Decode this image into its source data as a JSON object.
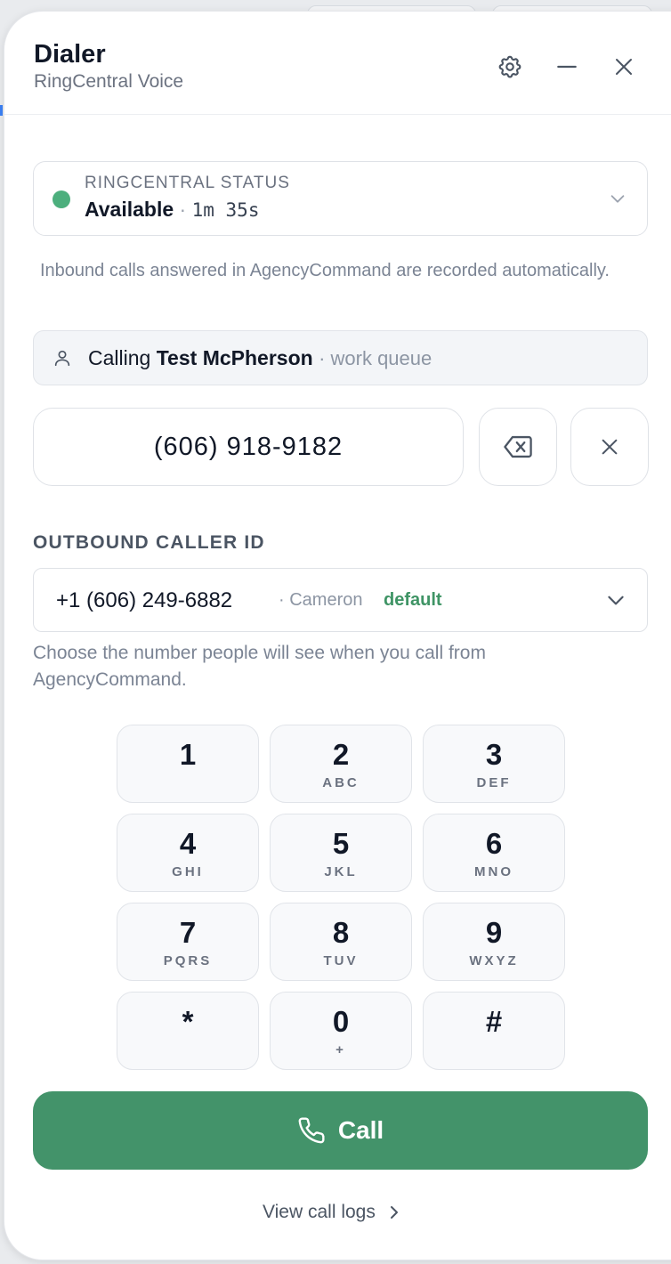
{
  "header": {
    "title": "Dialer",
    "subtitle": "RingCentral Voice"
  },
  "status": {
    "label": "RINGCENTRAL STATUS",
    "value": "Available",
    "separator": "·",
    "timer": "1m 35s",
    "dot_color": "#4caf7d"
  },
  "recording_note": "Inbound calls answered in AgencyCommand are recorded automatically.",
  "calling": {
    "prefix": "Calling",
    "name": "Test McPherson",
    "queue": "· work queue"
  },
  "number_input": {
    "value": "(606) 918-9182"
  },
  "caller_id": {
    "section_label": "OUTBOUND CALLER ID",
    "number": "+1 (606) 249-6882",
    "name": "· Cameron",
    "badge": "default",
    "helper": "Choose the number people will see when you call from AgencyCommand."
  },
  "keypad": [
    {
      "digit": "1",
      "letters": ""
    },
    {
      "digit": "2",
      "letters": "ABC"
    },
    {
      "digit": "3",
      "letters": "DEF"
    },
    {
      "digit": "4",
      "letters": "GHI"
    },
    {
      "digit": "5",
      "letters": "JKL"
    },
    {
      "digit": "6",
      "letters": "MNO"
    },
    {
      "digit": "7",
      "letters": "PQRS"
    },
    {
      "digit": "8",
      "letters": "TUV"
    },
    {
      "digit": "9",
      "letters": "WXYZ"
    },
    {
      "digit": "*",
      "letters": ""
    },
    {
      "digit": "0",
      "letters": "+"
    },
    {
      "digit": "#",
      "letters": ""
    }
  ],
  "call_button": {
    "label": "Call",
    "color": "#43936a"
  },
  "call_logs_link": {
    "label": "View call logs"
  },
  "icons": {
    "settings": "gear-icon",
    "minimize": "minimize-icon",
    "close": "close-icon",
    "backspace": "backspace-icon",
    "clear": "clear-icon",
    "person": "person-icon",
    "phone": "phone-icon",
    "chevron": "chevron-down-icon"
  }
}
